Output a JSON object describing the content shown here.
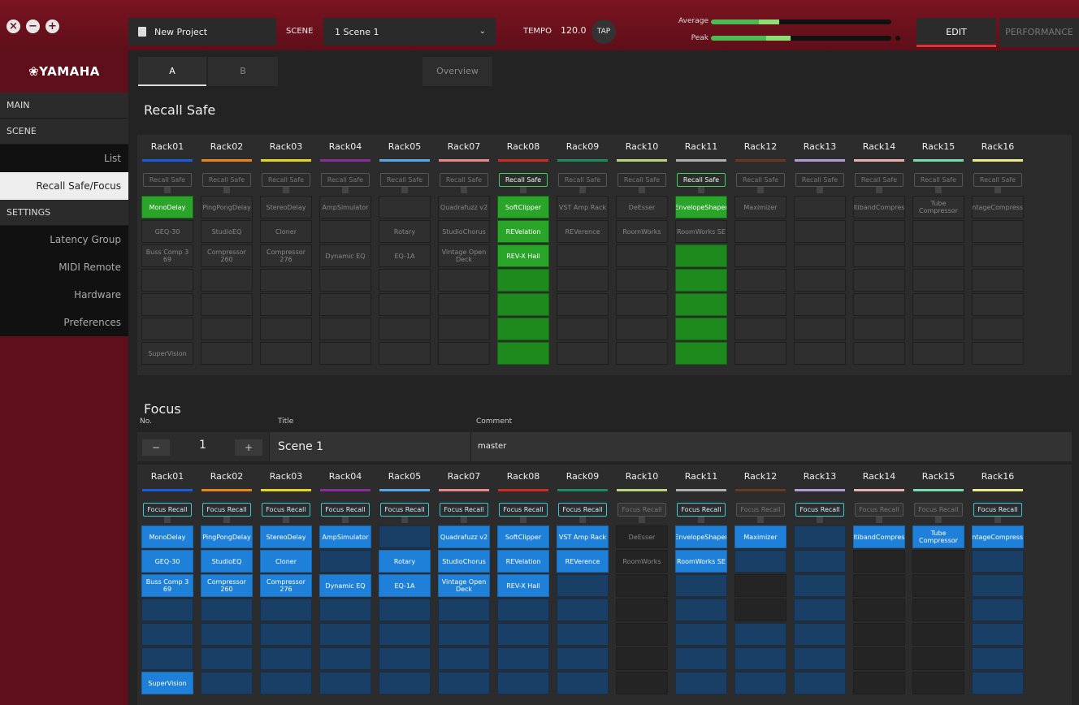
{
  "window": {
    "btn_close": "×",
    "btn_min": "−",
    "btn_max": "+"
  },
  "header": {
    "project": "New Project",
    "scene_label": "SCENE",
    "scene_value": "1  Scene 1",
    "tempo_label": "TEMPO",
    "tempo_value": "120.0",
    "tap_label": "TAP",
    "average_label": "Average",
    "peak_label": "Peak",
    "edit_label": "EDIT",
    "performance_label": "PERFORMANCE"
  },
  "meters": {
    "average_level": 0.38,
    "peak_level": 0.44
  },
  "sidebar": {
    "logo": "❀YAMAHA",
    "main": "MAIN",
    "scene": "SCENE",
    "scene_items": [
      "List",
      "Recall Safe/Focus"
    ],
    "settings": "SETTINGS",
    "settings_items": [
      "Latency Group",
      "MIDI Remote",
      "Hardware",
      "Preferences"
    ]
  },
  "tabs": {
    "a": "A",
    "b": "B",
    "overview": "Overview"
  },
  "recall_safe": {
    "title": "Recall Safe",
    "button_label": "Recall Safe"
  },
  "focus": {
    "title": "Focus",
    "no_label": "No.",
    "title_label": "Title",
    "comment_label": "Comment",
    "minus": "−",
    "plus": "+",
    "number": "1",
    "scene_title": "Scene 1",
    "comment": "master",
    "button_label": "Focus Recall"
  },
  "racks": [
    {
      "name": "Rack01",
      "color": "#1b5be0",
      "rs_on": false,
      "focus_on": true,
      "slots": [
        "MonoDelay",
        "GEQ-30",
        "Buss Comp 3 69",
        "",
        "",
        "",
        "SuperVision"
      ],
      "rs_slots": [
        true,
        false,
        false,
        false,
        false,
        false,
        false
      ],
      "f_slots": [
        true,
        true,
        true,
        true,
        true,
        true,
        true
      ]
    },
    {
      "name": "Rack02",
      "color": "#e8861b",
      "rs_on": false,
      "focus_on": true,
      "slots": [
        "PingPongDelay",
        "StudioEQ",
        "Compressor 260",
        "",
        "",
        "",
        ""
      ],
      "rs_slots": [
        false,
        false,
        false,
        false,
        false,
        false,
        false
      ],
      "f_slots": [
        true,
        true,
        true,
        true,
        true,
        true,
        true
      ]
    },
    {
      "name": "Rack03",
      "color": "#e6d61d",
      "rs_on": false,
      "focus_on": true,
      "slots": [
        "StereoDelay",
        "Cloner",
        "Compressor 276",
        "",
        "",
        "",
        ""
      ],
      "rs_slots": [
        false,
        false,
        false,
        false,
        false,
        false,
        false
      ],
      "f_slots": [
        true,
        true,
        true,
        true,
        true,
        true,
        true
      ]
    },
    {
      "name": "Rack04",
      "color": "#8a2c9a",
      "rs_on": false,
      "focus_on": true,
      "slots": [
        "AmpSimulator",
        "",
        "Dynamic EQ",
        "",
        "",
        "",
        ""
      ],
      "rs_slots": [
        false,
        false,
        false,
        false,
        false,
        false,
        false
      ],
      "f_slots": [
        true,
        true,
        true,
        true,
        true,
        true,
        true
      ]
    },
    {
      "name": "Rack05",
      "color": "#5aa7e6",
      "rs_on": false,
      "focus_on": true,
      "slots": [
        "",
        "Rotary",
        "EQ-1A",
        "",
        "",
        "",
        ""
      ],
      "rs_slots": [
        false,
        false,
        false,
        false,
        false,
        false,
        false
      ],
      "f_slots": [
        true,
        true,
        true,
        true,
        true,
        true,
        true
      ]
    },
    {
      "name": "Rack07",
      "color": "#e88a8a",
      "rs_on": false,
      "focus_on": true,
      "slots": [
        "Quadrafuzz v2",
        "StudioChorus",
        "Vintage Open Deck",
        "",
        "",
        "",
        ""
      ],
      "rs_slots": [
        false,
        false,
        false,
        false,
        false,
        false,
        false
      ],
      "f_slots": [
        true,
        true,
        true,
        true,
        true,
        true,
        true
      ]
    },
    {
      "name": "Rack08",
      "color": "#d02b20",
      "rs_on": true,
      "focus_on": true,
      "slots": [
        "SoftClipper",
        "REVelation",
        "REV-X Hall",
        "",
        "",
        "",
        ""
      ],
      "rs_slots": [
        true,
        true,
        true,
        true,
        true,
        true,
        true
      ],
      "f_slots": [
        true,
        true,
        true,
        true,
        true,
        true,
        true
      ]
    },
    {
      "name": "Rack09",
      "color": "#1e8a5e",
      "rs_on": false,
      "focus_on": true,
      "slots": [
        "VST Amp Rack",
        "REVerence",
        "",
        "",
        "",
        "",
        ""
      ],
      "rs_slots": [
        false,
        false,
        false,
        false,
        false,
        false,
        false
      ],
      "f_slots": [
        true,
        true,
        true,
        true,
        true,
        true,
        true
      ]
    },
    {
      "name": "Rack10",
      "color": "#b8d67a",
      "rs_on": false,
      "focus_on": false,
      "slots": [
        "DeEsser",
        "RoomWorks",
        "",
        "",
        "",
        "",
        ""
      ],
      "rs_slots": [
        false,
        false,
        false,
        false,
        false,
        false,
        false
      ],
      "f_slots": [
        false,
        false,
        false,
        false,
        false,
        false,
        false
      ]
    },
    {
      "name": "Rack11",
      "color": "#b0b0b0",
      "rs_on": true,
      "focus_on": true,
      "slots": [
        "EnvelopeShaper",
        "RoomWorks SE",
        "",
        "",
        "",
        "",
        ""
      ],
      "rs_slots": [
        true,
        false,
        true,
        true,
        true,
        true,
        true
      ],
      "f_slots": [
        true,
        true,
        true,
        true,
        true,
        true,
        true
      ]
    },
    {
      "name": "Rack12",
      "color": "#6b3a1a",
      "rs_on": false,
      "focus_on": false,
      "slots": [
        "Maximizer",
        "",
        "",
        "",
        "",
        "",
        ""
      ],
      "rs_slots": [
        false,
        false,
        false,
        false,
        false,
        false,
        false
      ],
      "f_slots": [
        true,
        true,
        false,
        false,
        true,
        true,
        true
      ]
    },
    {
      "name": "Rack13",
      "color": "#b59ad8",
      "rs_on": false,
      "focus_on": true,
      "slots": [
        "",
        "",
        "",
        "",
        "",
        "",
        ""
      ],
      "rs_slots": [
        false,
        false,
        false,
        false,
        false,
        false,
        false
      ],
      "f_slots": [
        true,
        true,
        true,
        true,
        true,
        true,
        true
      ]
    },
    {
      "name": "Rack14",
      "color": "#e8b0b0",
      "rs_on": false,
      "focus_on": false,
      "slots": [
        "MultibandCompressor",
        "",
        "",
        "",
        "",
        "",
        ""
      ],
      "rs_slots": [
        false,
        false,
        false,
        false,
        false,
        false,
        false
      ],
      "f_slots": [
        true,
        false,
        false,
        false,
        false,
        false,
        false
      ]
    },
    {
      "name": "Rack15",
      "color": "#7adbb0",
      "rs_on": false,
      "focus_on": false,
      "slots": [
        "Tube Compressor",
        "",
        "",
        "",
        "",
        "",
        ""
      ],
      "rs_slots": [
        false,
        false,
        false,
        false,
        false,
        false,
        false
      ],
      "f_slots": [
        true,
        false,
        false,
        false,
        false,
        false,
        false
      ]
    },
    {
      "name": "Rack16",
      "color": "#f0e890",
      "rs_on": false,
      "focus_on": true,
      "slots": [
        "VintageCompressor",
        "",
        "",
        "",
        "",
        "",
        ""
      ],
      "rs_slots": [
        false,
        false,
        false,
        false,
        false,
        false,
        false
      ],
      "f_slots": [
        true,
        true,
        true,
        true,
        true,
        true,
        true
      ]
    }
  ]
}
